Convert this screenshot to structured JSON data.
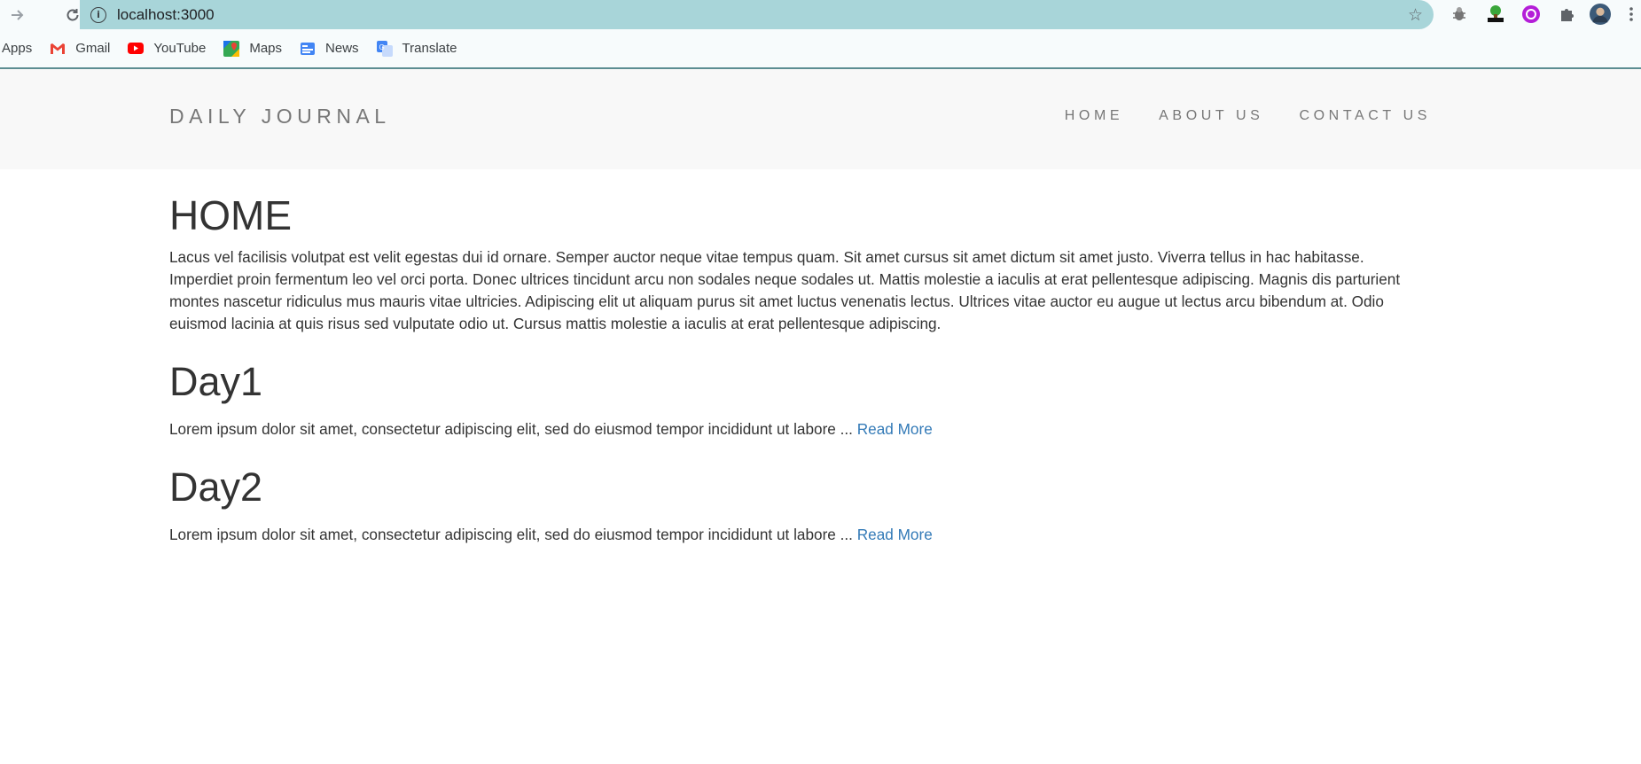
{
  "browser": {
    "url": "localhost:3000",
    "bookmarks": [
      {
        "label": "Apps",
        "icon": "apps-icon"
      },
      {
        "label": "Gmail",
        "icon": "gmail-icon"
      },
      {
        "label": "YouTube",
        "icon": "youtube-icon"
      },
      {
        "label": "Maps",
        "icon": "maps-icon"
      },
      {
        "label": "News",
        "icon": "news-icon"
      },
      {
        "label": "Translate",
        "icon": "translate-icon"
      }
    ]
  },
  "site": {
    "brand": "DAILY JOURNAL",
    "nav": [
      "HOME",
      "ABOUT US",
      "CONTACT US"
    ]
  },
  "main": {
    "title": "HOME",
    "intro": "Lacus vel facilisis volutpat est velit egestas dui id ornare. Semper auctor neque vitae tempus quam. Sit amet cursus sit amet dictum sit amet justo. Viverra tellus in hac habitasse. Imperdiet proin fermentum leo vel orci porta. Donec ultrices tincidunt arcu non sodales neque sodales ut. Mattis molestie a iaculis at erat pellentesque adipiscing. Magnis dis parturient montes nascetur ridiculus mus mauris vitae ultricies. Adipiscing elit ut aliquam purus sit amet luctus venenatis lectus. Ultrices vitae auctor eu augue ut lectus arcu bibendum at. Odio euismod lacinia at quis risus sed vulputate odio ut. Cursus mattis molestie a iaculis at erat pellentesque adipiscing.",
    "posts": [
      {
        "title": "Day1",
        "excerpt": "Lorem ipsum dolor sit amet, consectetur adipiscing elit, sed do eiusmod tempor incididunt ut labore ...",
        "link": "Read More"
      },
      {
        "title": "Day2",
        "excerpt": "Lorem ipsum dolor sit amet, consectetur adipiscing elit, sed do eiusmod tempor incididunt ut labore ...",
        "link": "Read More"
      }
    ]
  },
  "colors": {
    "omnibox": "#a8d5d9",
    "navbar_bg": "#f8f8f8",
    "nav_text": "#777777",
    "body_text": "#333333",
    "link": "#337ab7"
  }
}
